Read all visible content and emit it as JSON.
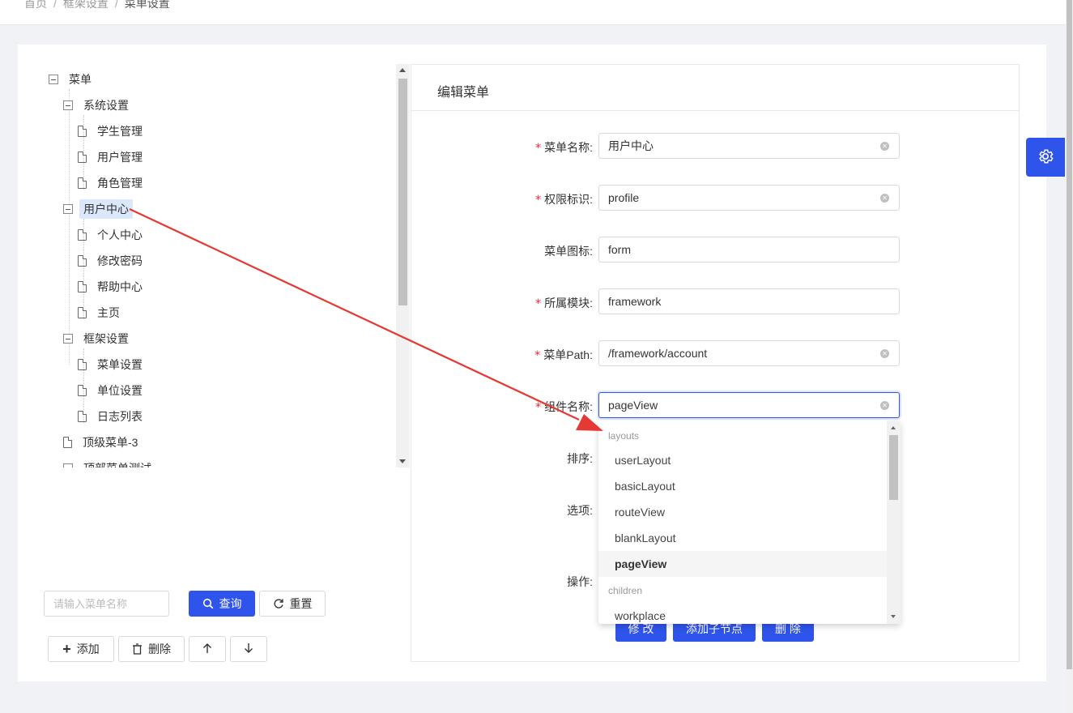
{
  "breadcrumb": {
    "home": "首页",
    "parent": "框架设置",
    "current": "菜单设置",
    "sep": "/"
  },
  "tree": {
    "root": "菜单",
    "nodes": [
      "系统设置",
      "学生管理",
      "用户管理",
      "角色管理",
      "用户中心",
      "个人中心",
      "修改密码",
      "帮助中心",
      "主页",
      "框架设置",
      "菜单设置",
      "单位设置",
      "日志列表",
      "顶级菜单-3",
      "顶部菜单测试"
    ]
  },
  "search": {
    "placeholder": "请输入菜单名称",
    "query_label": "查询",
    "reset_label": "重置"
  },
  "actions": {
    "add_label": "添加",
    "delete_label": "删除",
    "up_icon": "arrow-up-icon",
    "down_icon": "arrow-down-icon"
  },
  "editor": {
    "title": "编辑菜单",
    "fields": {
      "name": {
        "label": "菜单名称:",
        "value": "用户中心",
        "required": true
      },
      "permission": {
        "label": "权限标识:",
        "value": "profile",
        "required": true
      },
      "icon": {
        "label": "菜单图标:",
        "value": "form",
        "required": false
      },
      "module": {
        "label": "所属模块:",
        "value": "framework",
        "required": true
      },
      "path": {
        "label": "菜单Path:",
        "value": "/framework/account",
        "required": true
      },
      "component": {
        "label": "组件名称:",
        "value": "pageView",
        "required": true
      },
      "sort": {
        "label": "排序:"
      },
      "options": {
        "label": "选项:"
      },
      "operation": {
        "label": "操作:"
      }
    },
    "buttons": {
      "modify": "修 改",
      "add_child": "添加子节点",
      "delete": "删 除"
    }
  },
  "dropdown": {
    "groups": [
      {
        "name": "layouts",
        "items": [
          "userLayout",
          "basicLayout",
          "routeView",
          "blankLayout",
          "pageView"
        ]
      },
      {
        "name": "children",
        "items": [
          "workplace"
        ]
      }
    ],
    "selected": "pageView"
  },
  "colors": {
    "primary": "#2f54eb",
    "required": "#f5222d",
    "annotation_arrow": "#e53935"
  },
  "settings_icon": "gear-icon"
}
